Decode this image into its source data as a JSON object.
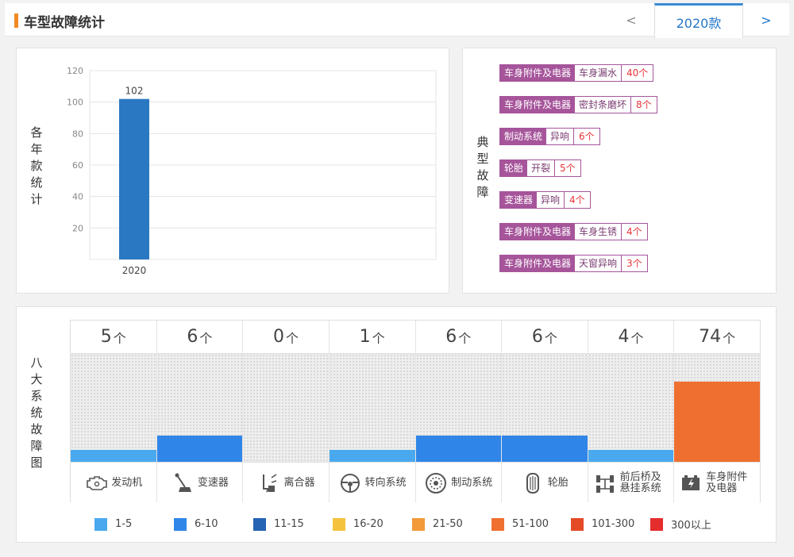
{
  "header": {
    "title": "车型故障统计",
    "prev_label": "<",
    "year_tab": "2020款",
    "next_label": ">"
  },
  "bar_panel": {
    "side_label": "各年款统计"
  },
  "chart_data": {
    "type": "bar",
    "categories": [
      "2020"
    ],
    "values": [
      102
    ],
    "data_labels": [
      "102"
    ],
    "yticks": [
      20,
      40,
      60,
      80,
      100,
      120
    ],
    "ylim": [
      0,
      120
    ],
    "grid": true,
    "bar_color": "#2b78c2"
  },
  "fault_panel": {
    "side_label": "典型故障",
    "faults": [
      {
        "category": "车身附件及电器",
        "desc": "车身漏水",
        "count": "40个"
      },
      {
        "category": "车身附件及电器",
        "desc": "密封条磨坏",
        "count": "8个"
      },
      {
        "category": "制动系统",
        "desc": "异响",
        "count": "6个"
      },
      {
        "category": "轮胎",
        "desc": "开裂",
        "count": "5个"
      },
      {
        "category": "变速器",
        "desc": "异响",
        "count": "4个"
      },
      {
        "category": "车身附件及电器",
        "desc": "车身生锈",
        "count": "4个"
      },
      {
        "category": "车身附件及电器",
        "desc": "天窗异响",
        "count": "3个"
      }
    ]
  },
  "systems_panel": {
    "side_label": "八大系统故障图",
    "unit": "个",
    "systems": [
      {
        "count": "5",
        "label": "发动机",
        "icon": "engine-icon",
        "level": 0.11,
        "color": "#4aa9ee"
      },
      {
        "count": "6",
        "label": "变速器",
        "icon": "gear-shift-icon",
        "level": 0.24,
        "color": "#2f86e8"
      },
      {
        "count": "0",
        "label": "离合器",
        "icon": "clutch-icon",
        "level": 0,
        "color": "#4aa9ee"
      },
      {
        "count": "1",
        "label": "转向系统",
        "icon": "steering-wheel-icon",
        "level": 0.11,
        "color": "#4aa9ee"
      },
      {
        "count": "6",
        "label": "制动系统",
        "icon": "brake-disc-icon",
        "level": 0.24,
        "color": "#2f86e8"
      },
      {
        "count": "6",
        "label": "轮胎",
        "icon": "tire-icon",
        "level": 0.24,
        "color": "#2f86e8"
      },
      {
        "count": "4",
        "label": "前后桥及悬挂系统",
        "icon": "axle-suspension-icon",
        "level": 0.11,
        "color": "#4aa9ee"
      },
      {
        "count": "74",
        "label": "车身附件及电器",
        "icon": "battery-icon",
        "level": 0.74,
        "color": "#ef6f30"
      }
    ],
    "legend": [
      {
        "label": "1-5",
        "color": "#4aa9ee"
      },
      {
        "label": "6-10",
        "color": "#2f86e8"
      },
      {
        "label": "11-15",
        "color": "#2563b3"
      },
      {
        "label": "16-20",
        "color": "#f5c23d"
      },
      {
        "label": "21-50",
        "color": "#f29a3a"
      },
      {
        "label": "51-100",
        "color": "#ef6f30"
      },
      {
        "label": "101-300",
        "color": "#e44a26"
      },
      {
        "label": "300以上",
        "color": "#e52d2d"
      }
    ]
  }
}
